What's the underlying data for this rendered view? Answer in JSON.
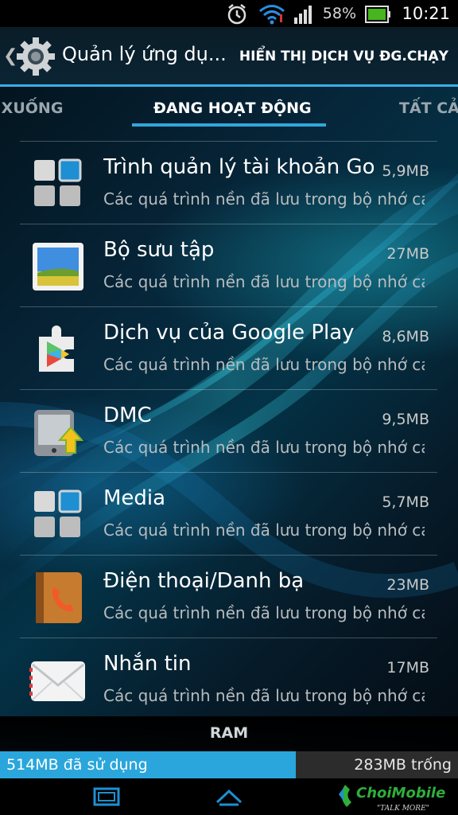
{
  "status_bar": {
    "battery_percent": "58%",
    "time": "10:21",
    "icons": [
      "alarm-icon",
      "wifi-icon",
      "signal-icon",
      "battery-icon"
    ]
  },
  "action_bar": {
    "title": "Quản lý ứng dụ...",
    "action": "HIỂN THỊ DỊCH VỤ ĐG.CHẠY"
  },
  "tabs": [
    {
      "label": "I XUỐNG"
    },
    {
      "label": "ĐANG HOẠT ĐỘNG"
    },
    {
      "label": "TẤT CẢ"
    }
  ],
  "apps": [
    {
      "name": "Trình quản lý tài khoản Google",
      "size": "5,9MB",
      "desc": "Các quá trình nền đã lưu trong bộ nhớ cache",
      "icon": "grid-app-icon"
    },
    {
      "name": "Bộ sưu tập",
      "size": "27MB",
      "desc": "Các quá trình nền đã lưu trong bộ nhớ cache",
      "icon": "gallery-icon"
    },
    {
      "name": "Dịch vụ của Google Play",
      "size": "8,6MB",
      "desc": "Các quá trình nền đã lưu trong bộ nhớ cache",
      "icon": "google-play-services-icon"
    },
    {
      "name": "DMC",
      "size": "9,5MB",
      "desc": "Các quá trình nền đã lưu trong bộ nhớ cache",
      "icon": "dmc-update-icon"
    },
    {
      "name": "Media",
      "size": "5,7MB",
      "desc": "Các quá trình nền đã lưu trong bộ nhớ cache",
      "icon": "grid-app-icon"
    },
    {
      "name": "Điện thoại/Danh bạ",
      "size": "23MB",
      "desc": "Các quá trình nền đã lưu trong bộ nhớ cache",
      "icon": "phone-contacts-icon"
    },
    {
      "name": "Nhắn tin",
      "size": "17MB",
      "desc": "Các quá trình nền đã lưu trong bộ nhớ cache",
      "icon": "messaging-icon"
    }
  ],
  "ram": {
    "label": "RAM",
    "used": "514MB đã sử dụng",
    "free": "283MB trống",
    "used_fraction": 0.645
  },
  "watermark": {
    "brand": "ChoiMobile",
    "tagline": "TALK MORE"
  },
  "colors": {
    "accent": "#2fa8dd",
    "ram_used": "#2aa6dc"
  }
}
